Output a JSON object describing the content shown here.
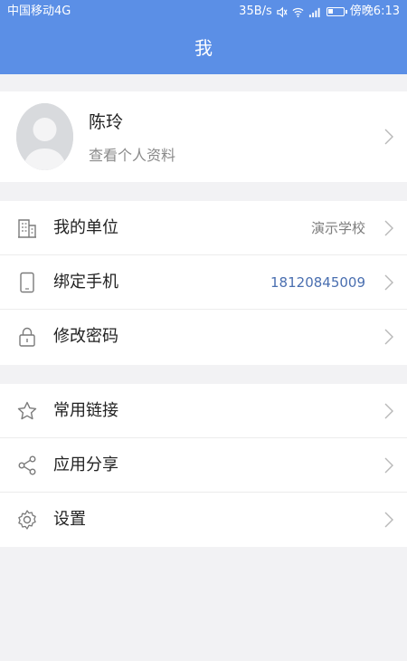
{
  "status_bar": {
    "carrier": "中国移动4G",
    "speed": "35B/s",
    "time": "傍晚6:13"
  },
  "header": {
    "title": "我"
  },
  "profile": {
    "name": "陈玲",
    "subtitle": "查看个人资料"
  },
  "group1": [
    {
      "label": "我的单位",
      "value": "演示学校",
      "icon": "building-icon"
    },
    {
      "label": "绑定手机",
      "value": "18120845009",
      "icon": "phone-icon"
    },
    {
      "label": "修改密码",
      "value": "",
      "icon": "lock-icon"
    }
  ],
  "group2": [
    {
      "label": "常用链接",
      "icon": "star-icon"
    },
    {
      "label": "应用分享",
      "icon": "share-icon"
    },
    {
      "label": "设置",
      "icon": "gear-icon"
    }
  ],
  "colors": {
    "header": "#5b8fe6",
    "phone_value": "#4a6fb0",
    "background": "#f2f2f4"
  }
}
